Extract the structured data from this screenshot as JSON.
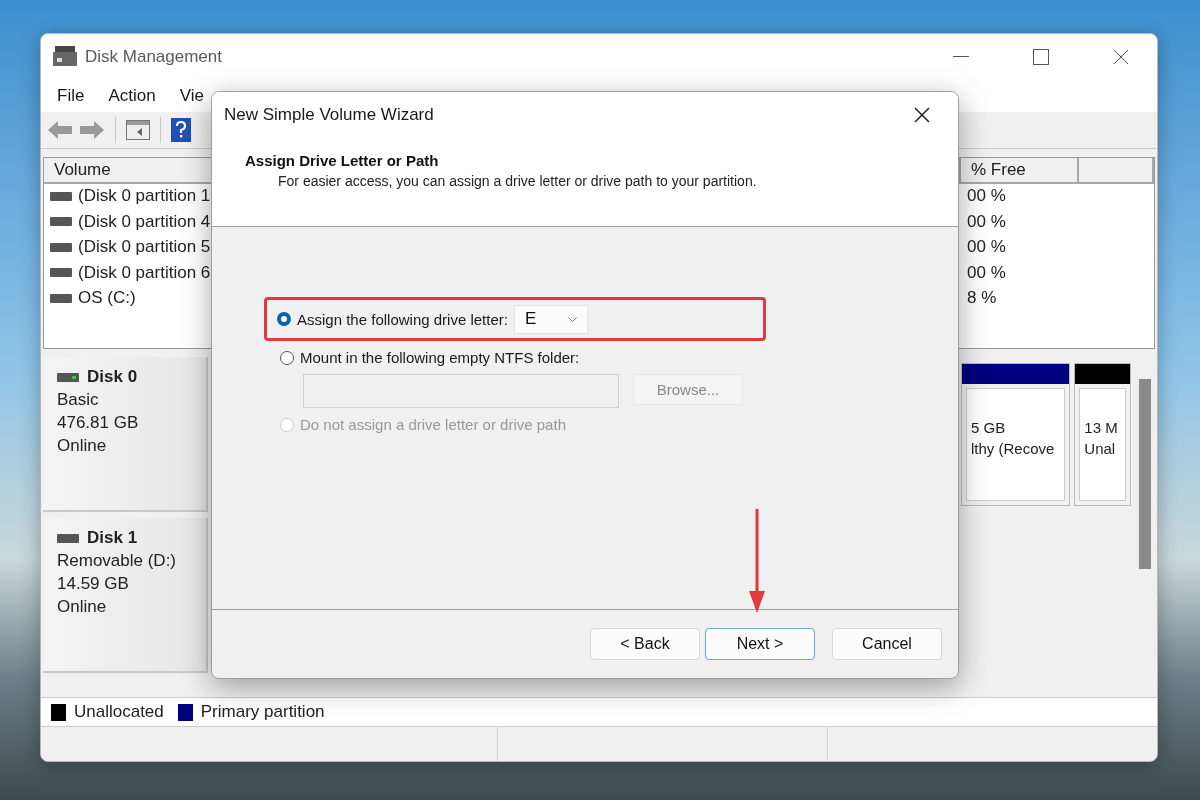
{
  "window": {
    "title": "Disk Management",
    "menu": [
      "File",
      "Action",
      "Vie"
    ]
  },
  "volume_list": {
    "columns": [
      "Volume",
      "% Free"
    ],
    "rows": [
      {
        "volume": "(Disk 0 partition 1",
        "free": "00 %"
      },
      {
        "volume": "(Disk 0 partition 4",
        "free": "00 %"
      },
      {
        "volume": "(Disk 0 partition 5",
        "free": "00 %"
      },
      {
        "volume": "(Disk 0 partition 6",
        "free": "00 %"
      },
      {
        "volume": "OS (C:)",
        "free": "8 %"
      }
    ]
  },
  "disks": [
    {
      "name": "Disk 0",
      "type": "Basic",
      "size": "476.81 GB",
      "status": "Online",
      "online": true,
      "partitions": [
        {
          "size": "5 GB",
          "status": "lthy (Recove",
          "color": "#000080"
        },
        {
          "size": "13 M",
          "status": "Unal",
          "color": "#000000"
        }
      ]
    },
    {
      "name": "Disk 1",
      "type": "Removable (D:)",
      "size": "14.59 GB",
      "status": "Online",
      "online": false
    }
  ],
  "legend": [
    {
      "label": "Unallocated",
      "color": "#000000"
    },
    {
      "label": "Primary partition",
      "color": "#000080"
    }
  ],
  "dialog": {
    "title": "New Simple Volume Wizard",
    "heading": "Assign Drive Letter or Path",
    "subtitle": "For easier access, you can assign a drive letter or drive path to your partition.",
    "options": [
      {
        "kind": "letter",
        "label": "Assign the following drive letter:",
        "selected": true,
        "disabled": false,
        "highlighted": true,
        "value": "E"
      },
      {
        "kind": "folder",
        "label": "Mount in the following empty NTFS folder:",
        "selected": false,
        "disabled": false,
        "highlighted": false,
        "browse": {
          "label": "Browse...",
          "disabled": true
        }
      },
      {
        "kind": "none",
        "label": "Do not assign a drive letter or drive path",
        "selected": false,
        "disabled": true,
        "highlighted": false
      }
    ],
    "buttons": [
      {
        "label": "< Back",
        "focused": false,
        "pointed": false
      },
      {
        "label": "Next >",
        "focused": true,
        "pointed": true
      },
      {
        "label": "Cancel",
        "focused": false,
        "pointed": false
      }
    ]
  }
}
